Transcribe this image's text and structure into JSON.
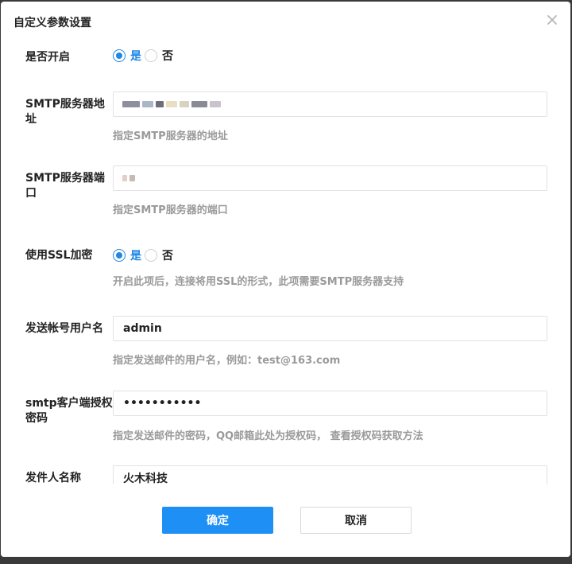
{
  "dialog": {
    "title": "自定义参数设置",
    "confirm_label": "确定",
    "cancel_label": "取消"
  },
  "fields": {
    "enabled": {
      "label": "是否开启",
      "options": [
        "是",
        "否"
      ],
      "selected": "是"
    },
    "smtp_host": {
      "label": "SMTP服务器地址",
      "value": "",
      "hint": "指定SMTP服务器的地址"
    },
    "smtp_port": {
      "label": "SMTP服务器端口",
      "value": "",
      "hint": "指定SMTP服务器的端口"
    },
    "use_ssl": {
      "label": "使用SSL加密",
      "options": [
        "是",
        "否"
      ],
      "selected": "是",
      "hint": "开启此项后，连接将用SSL的形式，此项需要SMTP服务器支持"
    },
    "username": {
      "label": "发送帐号用户名",
      "value": "admin",
      "hint": "指定发送邮件的用户名，例如：test@163.com"
    },
    "auth_code": {
      "label": "smtp客户端授权密码",
      "value": "•••••••••••",
      "hint": "指定发送邮件的密码，QQ邮箱此处为授权码， 查看授权码获取方法"
    },
    "sender_name": {
      "label": "发件人名称",
      "value": "火木科技"
    }
  },
  "icons": {
    "close": "close-icon"
  },
  "colors": {
    "accent": "#1e90f5",
    "hint": "#9a9a9a",
    "border": "#e2e2e2"
  }
}
